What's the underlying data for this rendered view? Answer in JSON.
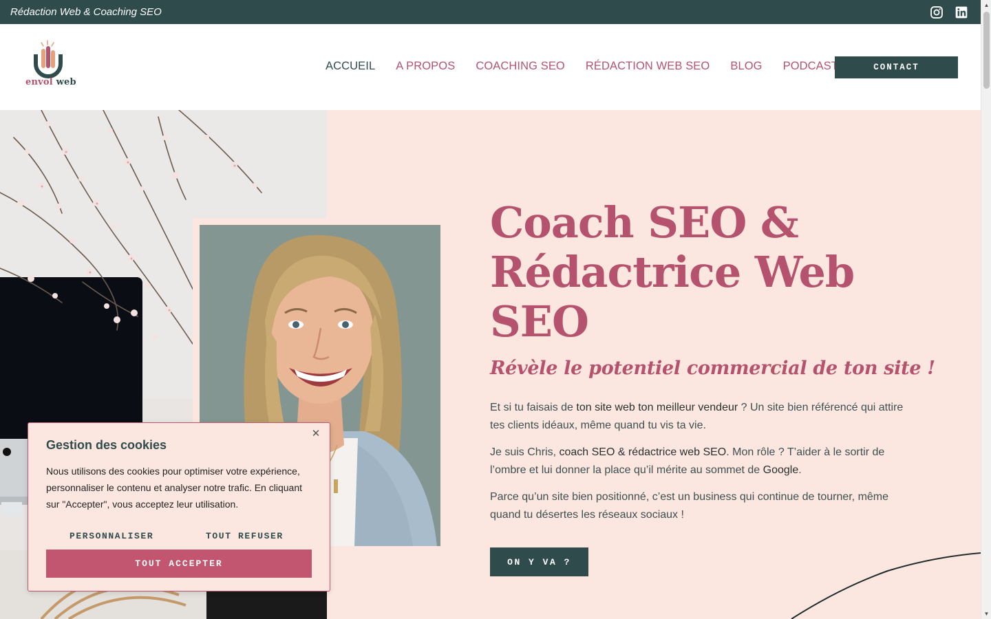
{
  "topbar": {
    "tagline": "Rédaction Web & Coaching SEO",
    "socials": [
      "instagram-icon",
      "linkedin-icon"
    ]
  },
  "brand": {
    "logo_word1": "envol",
    "logo_word2": "web",
    "colors": {
      "primary": "#2f4b4c",
      "accent": "#b5536f",
      "hero_bg": "#fbe7df"
    }
  },
  "nav": {
    "items": [
      "ACCUEIL",
      "A PROPOS",
      "COACHING SEO",
      "RÉDACTION WEB SEO",
      "BLOG",
      "PODCAST"
    ],
    "active": "ACCUEIL",
    "contact": "CONTACT"
  },
  "hero": {
    "title": "Coach SEO & Rédactrice Web SEO",
    "subtitle": "Révèle le potentiel commercial de ton site !",
    "p1_a": "Et si tu faisais de ",
    "p1_b": "ton site web ton meilleur vendeur",
    "p1_c": " ? Un site bien référencé qui attire tes clients idéaux, même quand tu vis ta vie.",
    "p2_a": "Je suis Chris, ",
    "p2_b": "coach SEO & rédactrice web SEO",
    "p2_c": ". Mon rôle ? T’aider à le sortir de l’ombre et lui donner la place qu’il mérite au sommet de ",
    "p2_d": "Google",
    "p2_e": ".",
    "p3": "Parce qu’un site bien positionné, c’est un business qui continue de tourner, même quand tu désertes les réseaux sociaux !",
    "cta": "ON Y VA ?"
  },
  "cookie": {
    "title": "Gestion des cookies",
    "text": "Nous utilisons des cookies pour optimiser votre expérience, personnaliser le contenu et analyser notre trafic. En cliquant sur \"Accepter\", vous acceptez leur utilisation.",
    "customize": "PERSONNALISER",
    "refuse": "TOUT REFUSER",
    "accept": "TOUT ACCEPTER",
    "close_icon": "close-icon"
  }
}
